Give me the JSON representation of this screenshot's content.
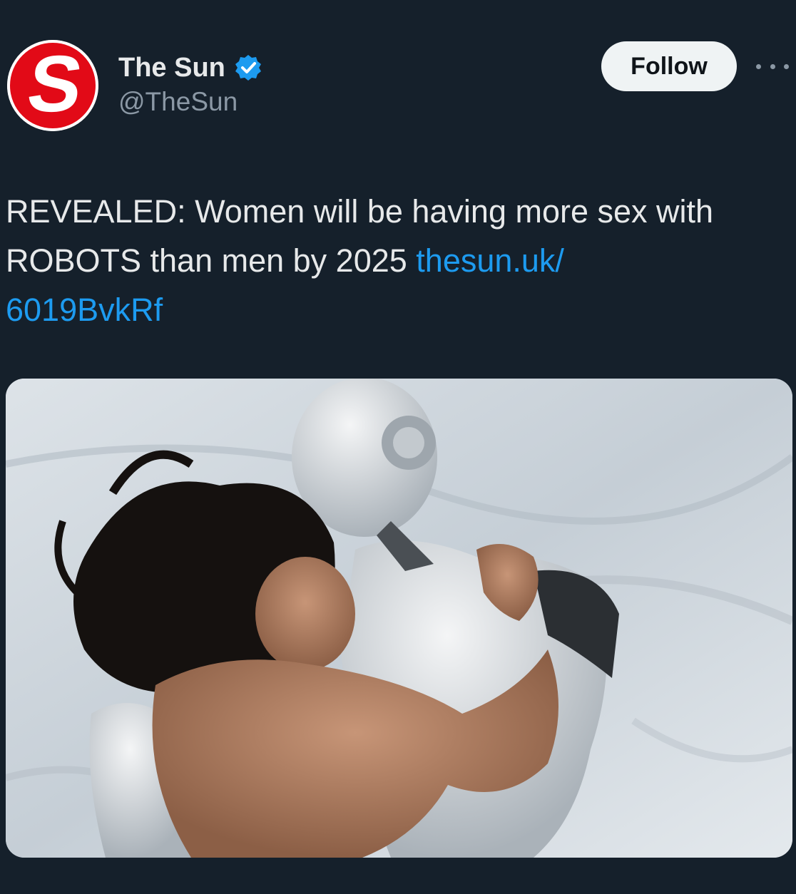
{
  "account": {
    "display_name": "The Sun",
    "handle": "@TheSun",
    "avatar_letter": "S",
    "verified_icon": "verified-badge-icon",
    "brand_color": "#e20a17"
  },
  "actions": {
    "follow_label": "Follow",
    "more_icon": "more-options-icon"
  },
  "tweet": {
    "text": "REVEALED: Women will be having more sex with ROBOTS than men by 2025 ",
    "link_part1": "thesun.uk/",
    "link_part2": "6019BvkRf"
  },
  "media": {
    "description_icon": "photo-image"
  },
  "colors": {
    "background": "#15202b",
    "link": "#1d9bf0",
    "verified": "#1d9bf0",
    "secondary_text": "#8b98a5"
  }
}
